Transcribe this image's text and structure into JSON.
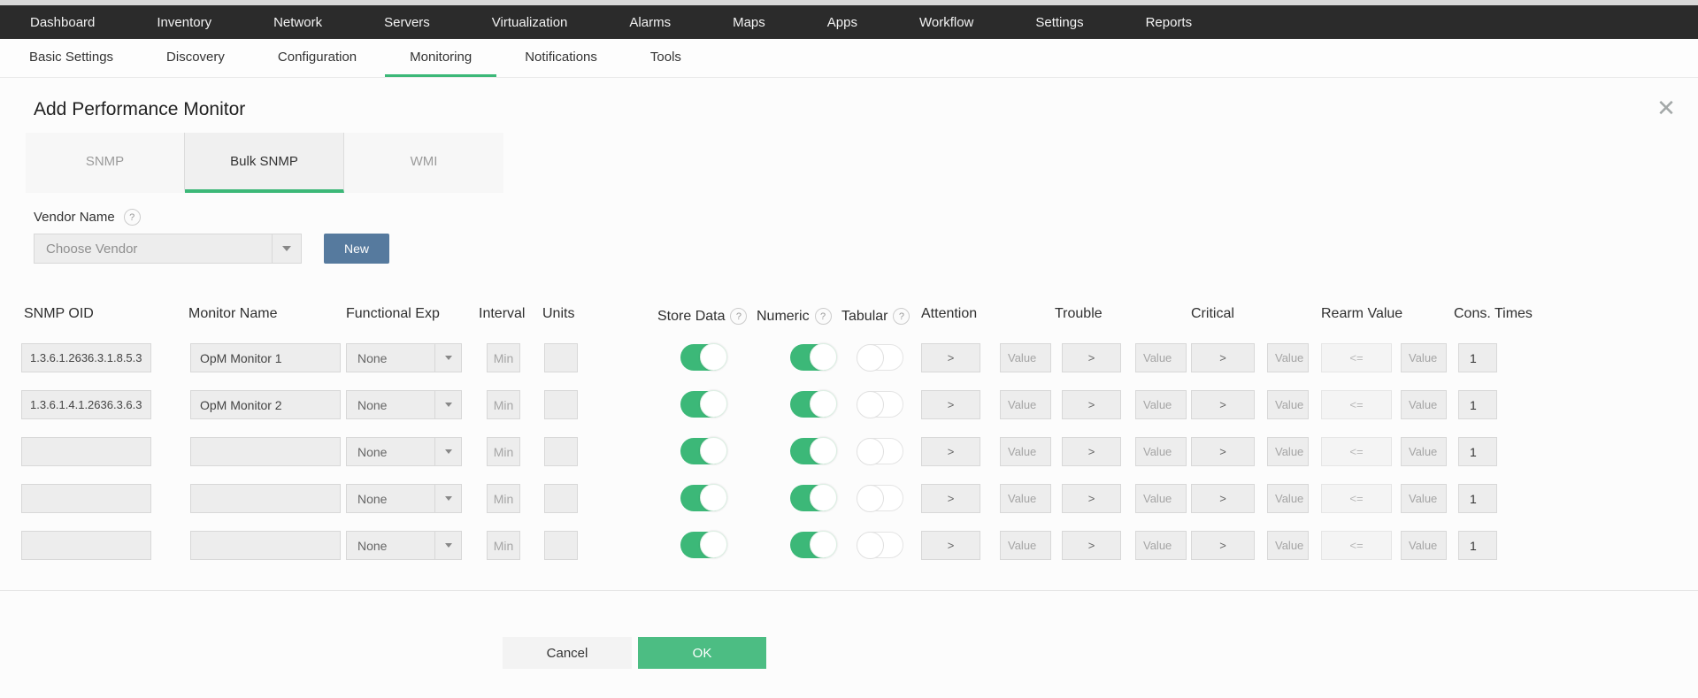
{
  "glyphs": {
    "help": "?",
    "close": "✕"
  },
  "colors": {
    "accent_green": "#3cb878",
    "ok_green": "#4cbd83",
    "new_button_blue": "#567a9e",
    "topnav_bg": "#2b2b2b"
  },
  "top_nav": {
    "items": [
      "Dashboard",
      "Inventory",
      "Network",
      "Servers",
      "Virtualization",
      "Alarms",
      "Maps",
      "Apps",
      "Workflow",
      "Settings",
      "Reports"
    ]
  },
  "sub_nav": {
    "items": [
      "Basic Settings",
      "Discovery",
      "Configuration",
      "Monitoring",
      "Notifications",
      "Tools"
    ],
    "active_index": 3
  },
  "dialog": {
    "title": "Add Performance Monitor",
    "tabs": {
      "items": [
        "SNMP",
        "Bulk SNMP",
        "WMI"
      ],
      "active_index": 1
    },
    "vendor": {
      "label": "Vendor Name",
      "dropdown_placeholder": "Choose Vendor",
      "new_button": "New"
    },
    "table": {
      "headers": [
        {
          "label": "SNMP OID"
        },
        {
          "label": "Monitor Name"
        },
        {
          "label": "Functional Exp"
        },
        {
          "label": "Interval"
        },
        {
          "label": "Units"
        },
        {
          "label": "Store Data",
          "help": true
        },
        {
          "label": "Numeric",
          "help": true
        },
        {
          "label": "Tabular",
          "help": true
        },
        {
          "label": "Attention"
        },
        {
          "label": "Trouble"
        },
        {
          "label": "Critical"
        },
        {
          "label": "Rearm Value"
        },
        {
          "label": "Cons. Times"
        }
      ],
      "rows": [
        {
          "oid": "1.3.6.1.2636.3.1.8.5.3",
          "monitor_name": "OpM Monitor 1",
          "functional_exp": "None",
          "interval_placeholder": "Min",
          "units_value": "",
          "store_data": true,
          "numeric": true,
          "tabular": false,
          "attention_op": ">",
          "trouble_op": ">",
          "critical_op": ">",
          "rearm_op": "<=",
          "value_placeholder": "Value",
          "cons_times": "1"
        },
        {
          "oid": "1.3.6.1.4.1.2636.3.6.3",
          "monitor_name": "OpM Monitor 2",
          "functional_exp": "None",
          "interval_placeholder": "Min",
          "units_value": "",
          "store_data": true,
          "numeric": true,
          "tabular": false,
          "attention_op": ">",
          "trouble_op": ">",
          "critical_op": ">",
          "rearm_op": "<=",
          "value_placeholder": "Value",
          "cons_times": "1"
        },
        {
          "oid": "",
          "monitor_name": "",
          "functional_exp": "None",
          "interval_placeholder": "Min",
          "units_value": "",
          "store_data": true,
          "numeric": true,
          "tabular": false,
          "attention_op": ">",
          "trouble_op": ">",
          "critical_op": ">",
          "rearm_op": "<=",
          "value_placeholder": "Value",
          "cons_times": "1"
        },
        {
          "oid": "",
          "monitor_name": "",
          "functional_exp": "None",
          "interval_placeholder": "Min",
          "units_value": "",
          "store_data": true,
          "numeric": true,
          "tabular": false,
          "attention_op": ">",
          "trouble_op": ">",
          "critical_op": ">",
          "rearm_op": "<=",
          "value_placeholder": "Value",
          "cons_times": "1"
        },
        {
          "oid": "",
          "monitor_name": "",
          "functional_exp": "None",
          "interval_placeholder": "Min",
          "units_value": "",
          "store_data": true,
          "numeric": true,
          "tabular": false,
          "attention_op": ">",
          "trouble_op": ">",
          "critical_op": ">",
          "rearm_op": "<=",
          "value_placeholder": "Value",
          "cons_times": "1"
        }
      ]
    },
    "footer": {
      "cancel_label": "Cancel",
      "ok_label": "OK"
    }
  }
}
